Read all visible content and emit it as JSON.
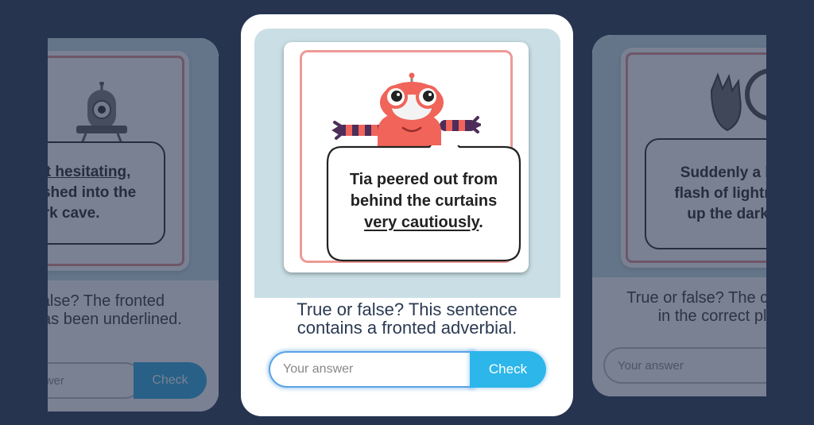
{
  "left_card": {
    "bubble_line1": "Without hesitating,",
    "bubble_line2": "Tom dashed into the",
    "bubble_line3": "dark cave.",
    "question": "True or false? The fronted adverbial has been underlined.",
    "input_placeholder": "Your answer",
    "check_label": "Check"
  },
  "main_card": {
    "character_icon": "red-robot-icon",
    "bubble_line1": "Tia peered out from",
    "bubble_line2": "behind the curtains",
    "bubble_underlined": "very cautiously",
    "bubble_end": ".",
    "question_line1": "True or false? This sentence",
    "question_line2": "contains a fronted adverbial.",
    "input_placeholder": "Your answer",
    "check_label": "Check"
  },
  "right_card": {
    "character_icon": "monster-claw-icon",
    "bubble_line1": "Suddenly a bright",
    "bubble_line2": "flash of lightning lit",
    "bubble_line3": "up the dark sky.",
    "question_line1": "True or false? The comma is",
    "question_line2": "in the correct place.",
    "input_placeholder": "Your answer"
  },
  "colors": {
    "background": "#263450",
    "picture_panel": "#c9dfe5",
    "frame_border": "#ed9a96",
    "check_button": "#2cb6ea",
    "robot": "#f0645a"
  }
}
